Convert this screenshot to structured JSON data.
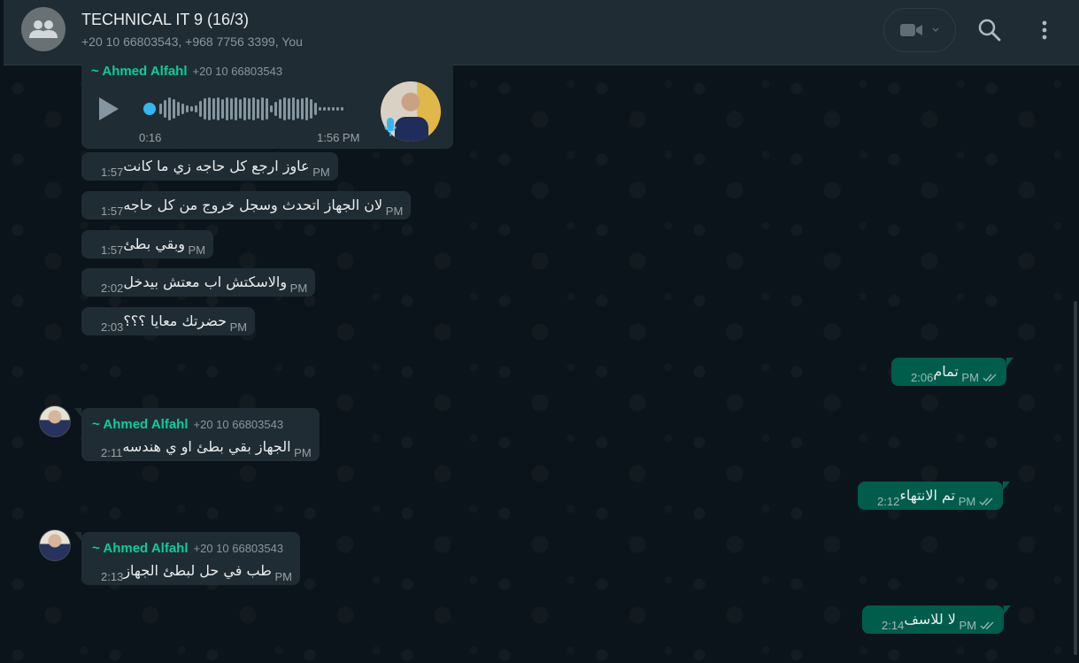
{
  "header": {
    "title": "TECHNICAL IT 9 (16/3)",
    "participants": "+20 10 66803543, +968 7756 3399, You"
  },
  "voice_message": {
    "sender": "~ Ahmed Alfahl",
    "phone": "+20 10 66803543",
    "duration": "0:16",
    "time": "1:56 PM"
  },
  "messages": [
    {
      "direction": "in",
      "text": "عاوز ارجع كل حاجه زي ما كانت",
      "time": "1:57 PM"
    },
    {
      "direction": "in",
      "text": "لان الجهاز اتحدث وسجل خروج من كل حاجه",
      "time": "1:57 PM"
    },
    {
      "direction": "in",
      "text": "وبقي بطئ",
      "time": "1:57 PM"
    },
    {
      "direction": "in",
      "text": "والاسكتش اب معتش بيدخل",
      "time": "2:02 PM"
    },
    {
      "direction": "in",
      "text": "حضرتك معايا ؟؟؟",
      "time": "2:03 PM"
    },
    {
      "direction": "out",
      "text": "تمام",
      "time": "2:06 PM"
    },
    {
      "direction": "in",
      "sender": "~ Ahmed Alfahl",
      "phone": "+20 10 66803543",
      "text": "الجهاز بقي بطئ او ي هندسه",
      "time": "2:11 PM"
    },
    {
      "direction": "out",
      "text": "تم الانتهاء",
      "time": "2:12 PM"
    },
    {
      "direction": "in",
      "sender": "~ Ahmed Alfahl",
      "phone": "+20 10 66803543",
      "text": "طب في حل لبطئ الجهاز",
      "time": "2:13 PM"
    },
    {
      "direction": "out",
      "text": "لا للاسف",
      "time": "2:14 PM"
    }
  ],
  "colors": {
    "incoming_bubble": "#202c33",
    "outgoing_bubble": "#005c4b",
    "sender_name": "#06cf9c",
    "background": "#0b141a"
  },
  "icons": [
    "group-icon",
    "video-call-icon",
    "chevron-down-icon",
    "search-icon",
    "menu-icon",
    "play-icon",
    "mic-icon",
    "double-check-icon"
  ]
}
